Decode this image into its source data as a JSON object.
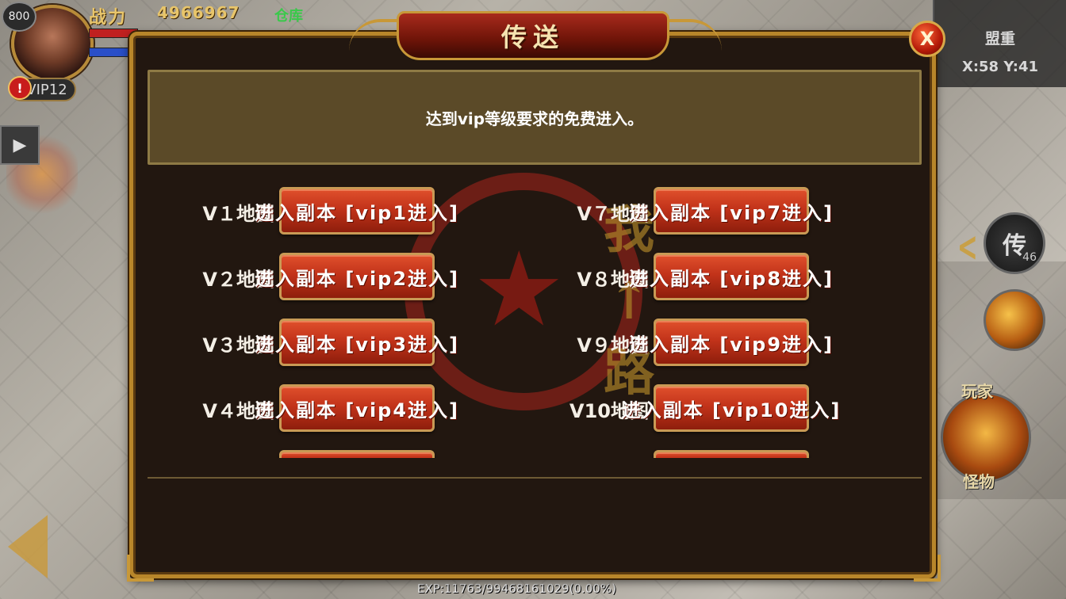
{
  "hud": {
    "level": "800",
    "power_label": "战力",
    "power_value": "4966967",
    "warehouse": "仓库",
    "vip": "VIP12",
    "alert": "!",
    "guild": "盟重",
    "coords": "X:58 Y:41",
    "player_label": "玩家",
    "monster_label": "怪物",
    "teleport_skill": "传",
    "teleport_count": "46",
    "exp": "EXP:11763/99468161029(0.00%)"
  },
  "dialog": {
    "title": "传送",
    "close_label": "X",
    "notice": "达到vip等级要求的免费进入。",
    "left_column": [
      {
        "map": "V１地图",
        "button": "进入副本 [vip1进入]"
      },
      {
        "map": "V２地图",
        "button": "进入副本 [vip2进入]"
      },
      {
        "map": "V３地图",
        "button": "进入副本 [vip3进入]"
      },
      {
        "map": "V４地图",
        "button": "进入副本 [vip4进入]"
      }
    ],
    "right_column": [
      {
        "map": "V７地图",
        "button": "进入副本 [vip7进入]"
      },
      {
        "map": "V８地图",
        "button": "进入副本 [vip8进入]"
      },
      {
        "map": "V９地图",
        "button": "进入副本 [vip9进入]"
      },
      {
        "map": "V10地图",
        "button": "进入副本 [vip10进入]"
      }
    ]
  },
  "watermark": {
    "text": "我↑路"
  },
  "colors": {
    "frame_gold": "#b8862a",
    "button_red": "#c2331a",
    "notice_bg": "#5b4a28",
    "panel_bg": "#221710"
  }
}
